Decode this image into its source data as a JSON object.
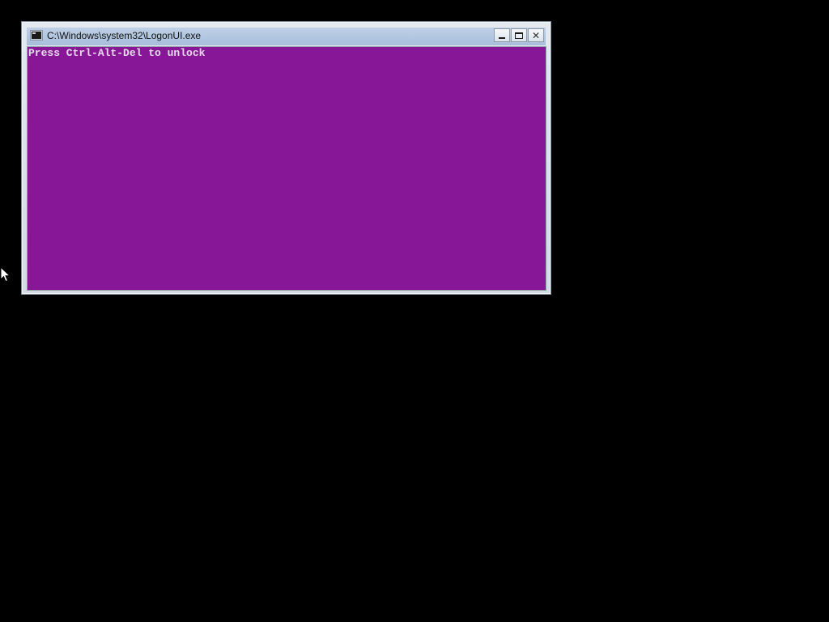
{
  "window": {
    "title": "C:\\Windows\\system32\\LogonUI.exe",
    "icon": "console-app-icon",
    "buttons": {
      "minimize": "minimize-icon",
      "maximize": "maximize-icon",
      "close": "close-icon"
    }
  },
  "console": {
    "background_color": "#881798",
    "text_color": "#e6dbea",
    "lines": [
      "Press Ctrl-Alt-Del to unlock"
    ]
  },
  "desktop": {
    "background_color": "#000000",
    "pointer": "mouse-pointer-icon"
  }
}
